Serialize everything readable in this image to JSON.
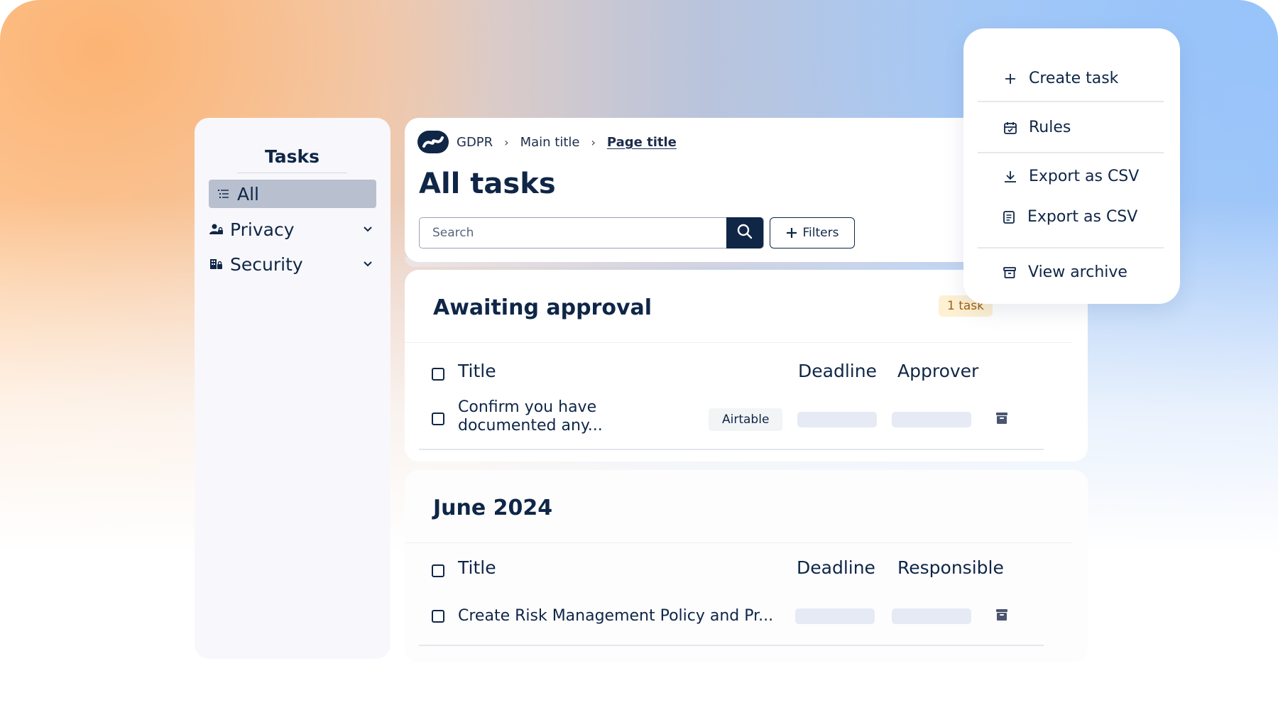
{
  "sidebar": {
    "title": "Tasks",
    "items": [
      {
        "label": "All",
        "icon": "list-icon",
        "active": true
      },
      {
        "label": "Privacy",
        "icon": "user-lock-icon",
        "expandable": true
      },
      {
        "label": "Security",
        "icon": "building-lock-icon",
        "expandable": true
      }
    ]
  },
  "header": {
    "breadcrumb": [
      "GDPR",
      "Main title",
      "Page title"
    ],
    "title": "All tasks",
    "search": {
      "placeholder": "Search",
      "value": ""
    },
    "filters_label": "Filters"
  },
  "sections": [
    {
      "title": "Awaiting approval",
      "badge": "1 task",
      "columns": [
        "Title",
        "Deadline",
        "Approver"
      ],
      "rows": [
        {
          "title_line1": "Confirm you have",
          "title_line2": "documented any...",
          "tag": "Airtable"
        }
      ]
    },
    {
      "title": "June 2024",
      "columns": [
        "Title",
        "Deadline",
        "Responsible"
      ],
      "rows": [
        {
          "title": "Create Risk Management Policy and Pr..."
        }
      ]
    }
  ],
  "menu": {
    "items": [
      {
        "label": "Create task",
        "icon": "plus-icon"
      },
      {
        "label": "Rules",
        "icon": "calendar-icon"
      },
      {
        "label": "Export as CSV",
        "icon": "download-icon"
      },
      {
        "label": "Export as CSV",
        "icon": "document-icon"
      },
      {
        "label": "View archive",
        "icon": "archive-icon"
      }
    ]
  },
  "colors": {
    "primary": "#0f2647",
    "badge_bg": "#fdf0d3",
    "badge_text": "#a3600c",
    "active_item": "#b8c0cf",
    "skeleton": "#e5eaf4"
  }
}
